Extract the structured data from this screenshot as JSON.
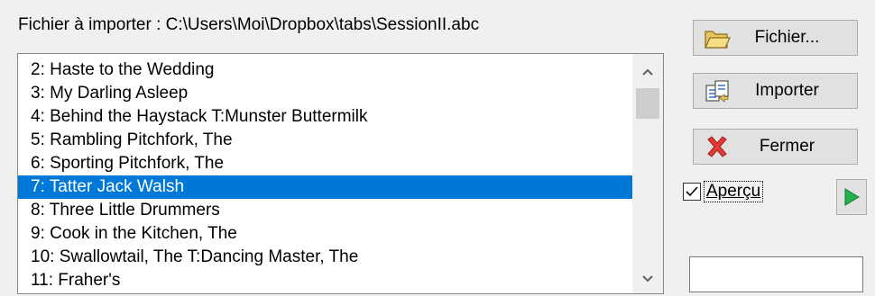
{
  "file_label": "Fichier à importer : C:\\Users\\Moi\\Dropbox\\tabs\\SessionII.abc",
  "tunes": [
    {
      "label": "2: Haste to the Wedding",
      "selected": false
    },
    {
      "label": "3: My Darling Asleep",
      "selected": false
    },
    {
      "label": "4: Behind the Haystack T:Munster Buttermilk",
      "selected": false
    },
    {
      "label": "5: Rambling Pitchfork, The",
      "selected": false
    },
    {
      "label": "6: Sporting Pitchfork, The",
      "selected": false
    },
    {
      "label": "7: Tatter Jack Walsh",
      "selected": true
    },
    {
      "label": "8: Three Little Drummers",
      "selected": false
    },
    {
      "label": "9: Cook in the Kitchen, The",
      "selected": false
    },
    {
      "label": "10: Swallowtail, The T:Dancing Master, The",
      "selected": false
    },
    {
      "label": "11: Fraher's",
      "selected": false
    }
  ],
  "buttons": {
    "fichier": "Fichier...",
    "importer": "Importer",
    "fermer": "Fermer"
  },
  "preview": {
    "label": "Aperçu",
    "checked": true
  },
  "text_field": {
    "value": ""
  },
  "colors": {
    "selection": "#0078d7",
    "play": "#22b14c",
    "close": "#e53935"
  }
}
